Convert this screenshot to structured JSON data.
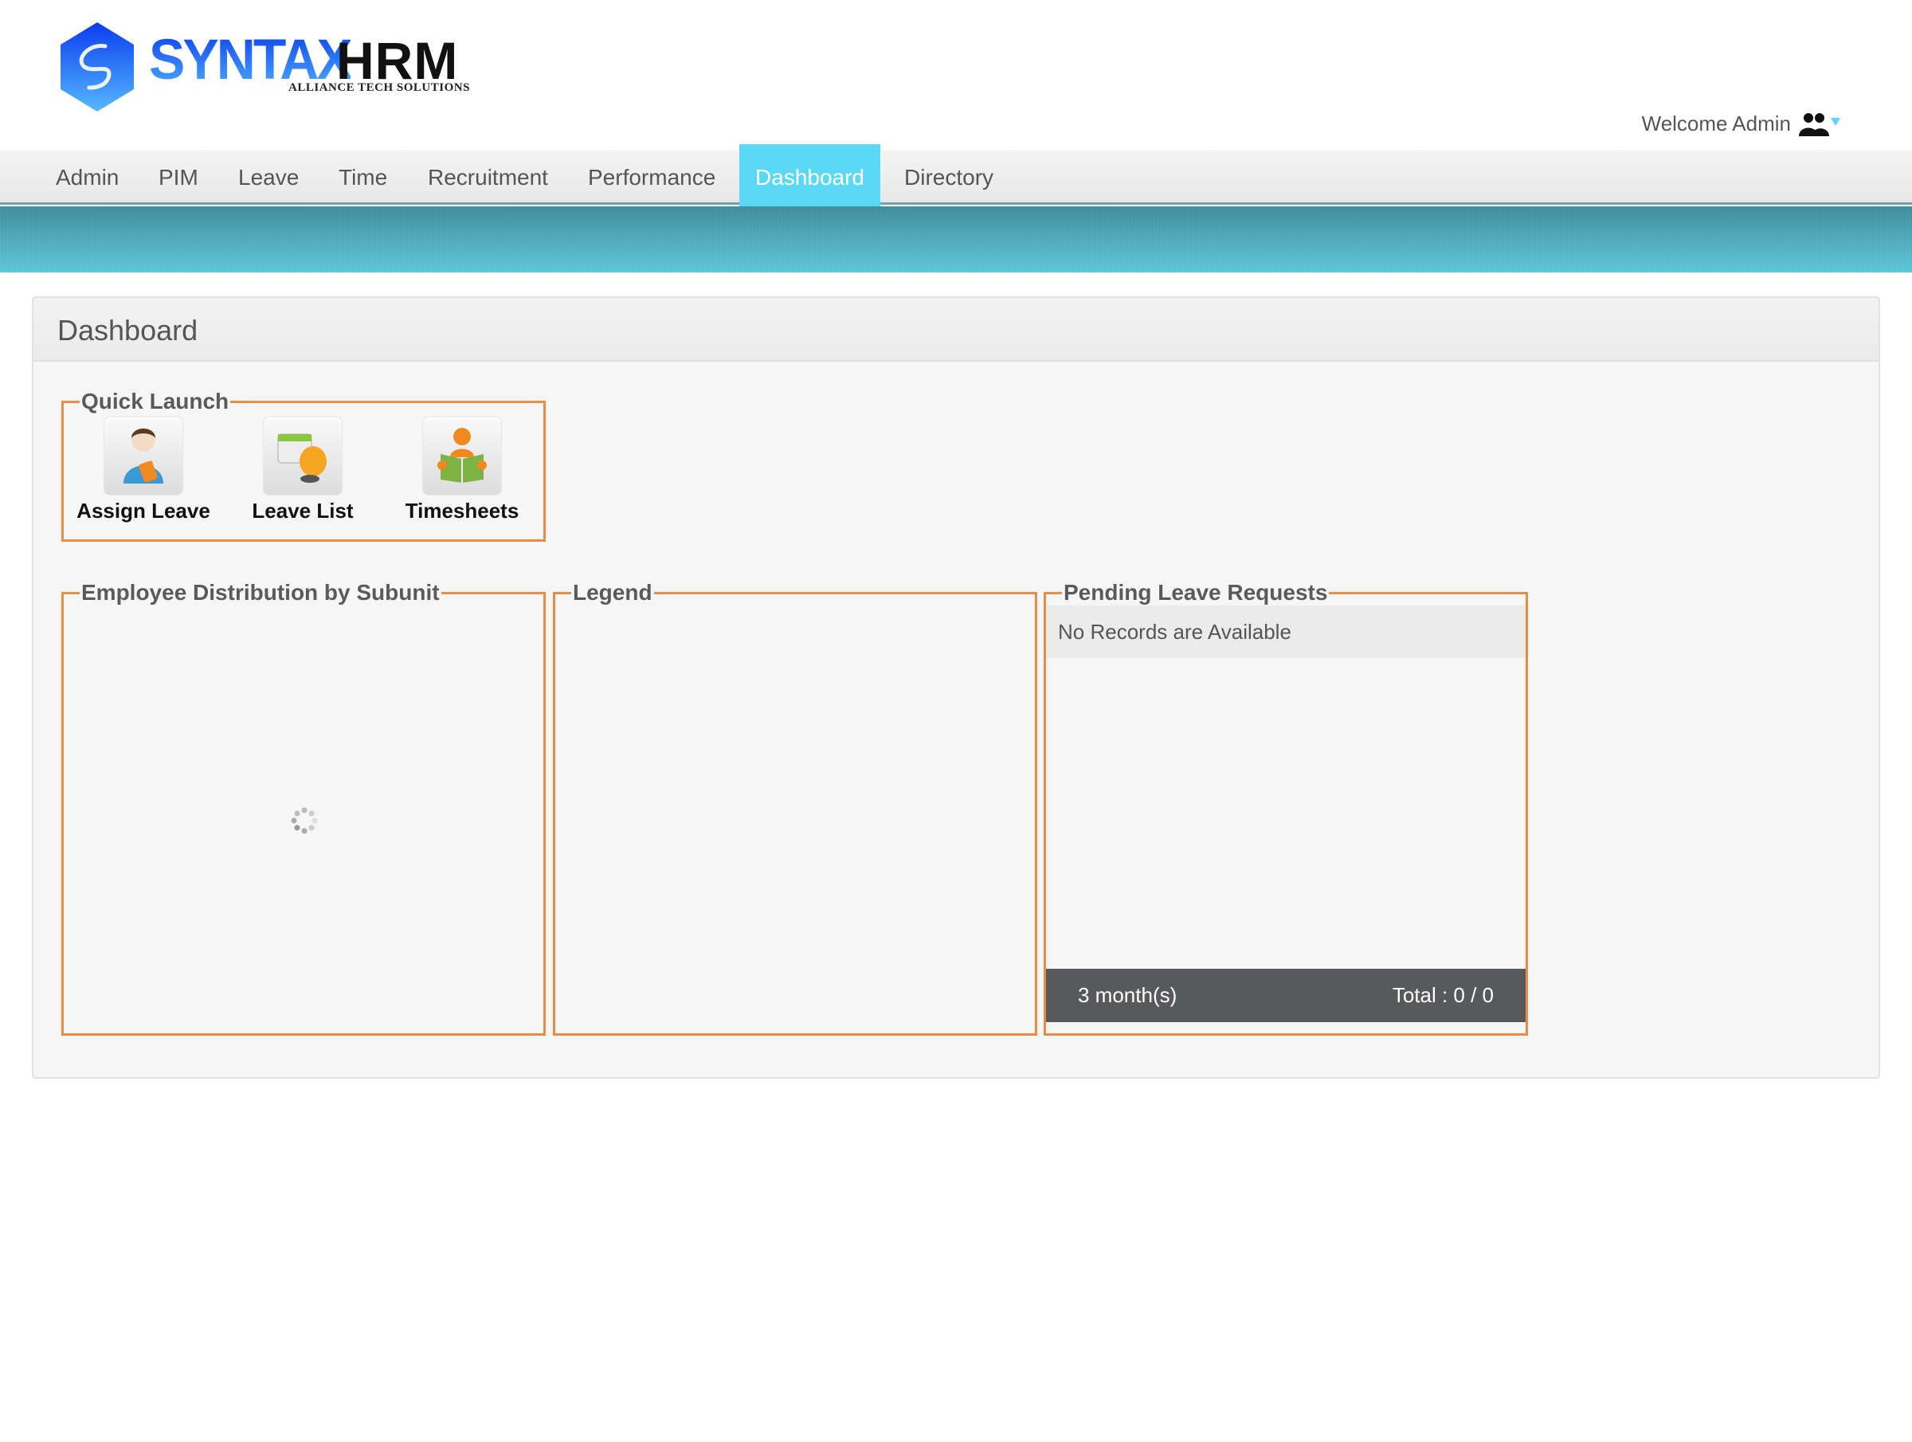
{
  "logo": {
    "brand_primary": "SYNTAX",
    "brand_secondary": "HRM",
    "tagline": "ALLIANCE TECH SOLUTIONS"
  },
  "header": {
    "welcome": "Welcome Admin",
    "user_icon": "users-icon",
    "dropdown_icon": "caret-down-icon"
  },
  "nav": {
    "items": [
      {
        "label": "Admin"
      },
      {
        "label": "PIM"
      },
      {
        "label": "Leave"
      },
      {
        "label": "Time"
      },
      {
        "label": "Recruitment"
      },
      {
        "label": "Performance"
      },
      {
        "label": "Dashboard",
        "active": true
      },
      {
        "label": "Directory"
      }
    ]
  },
  "page": {
    "title": "Dashboard"
  },
  "quick_launch": {
    "title": "Quick Launch",
    "items": [
      {
        "label": "Assign Leave",
        "icon": "assign-leave-icon"
      },
      {
        "label": "Leave List",
        "icon": "leave-list-icon"
      },
      {
        "label": "Timesheets",
        "icon": "timesheets-icon"
      }
    ]
  },
  "employee_distribution": {
    "title": "Employee Distribution by Subunit",
    "state": "loading"
  },
  "legend": {
    "title": "Legend"
  },
  "pending_leave": {
    "title": "Pending Leave Requests",
    "empty_message": "No Records are Available",
    "period": "3 month(s)",
    "total": "Total : 0 / 0"
  },
  "colors": {
    "accent": "#5ad8f5",
    "box_border": "#e68e48",
    "footer": "#58595b",
    "band": "#4aaabb"
  }
}
